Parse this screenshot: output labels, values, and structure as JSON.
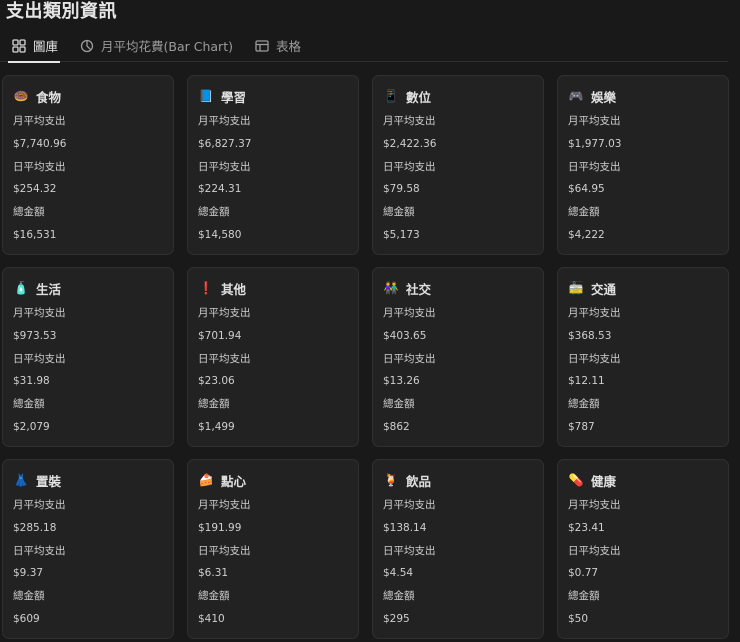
{
  "page": {
    "title": "支出類別資訊"
  },
  "tabs": [
    {
      "label": "圖庫",
      "icon": "gallery-icon",
      "active": true
    },
    {
      "label": "月平均花費(Bar Chart)",
      "icon": "chart-icon",
      "active": false
    },
    {
      "label": "表格",
      "icon": "table-icon",
      "active": false
    }
  ],
  "field_labels": {
    "monthly": "月平均支出",
    "daily": "日平均支出",
    "total": "總金額"
  },
  "cards": [
    {
      "emoji": "🍩",
      "emoji_name": "food-icon",
      "name": "食物",
      "monthly": "$7,740.96",
      "daily": "$254.32",
      "total": "$16,531"
    },
    {
      "emoji": "📘",
      "emoji_name": "book-icon",
      "name": "學習",
      "monthly": "$6,827.37",
      "daily": "$224.31",
      "total": "$14,580"
    },
    {
      "emoji": "📱",
      "emoji_name": "phone-icon",
      "name": "數位",
      "monthly": "$2,422.36",
      "daily": "$79.58",
      "total": "$5,173"
    },
    {
      "emoji": "🎮",
      "emoji_name": "game-icon",
      "name": "娛樂",
      "monthly": "$1,977.03",
      "daily": "$64.95",
      "total": "$4,222"
    },
    {
      "emoji": "🧴",
      "emoji_name": "living-icon",
      "name": "生活",
      "monthly": "$973.53",
      "daily": "$31.98",
      "total": "$2,079"
    },
    {
      "emoji": "❗",
      "emoji_name": "exclamation-icon",
      "name": "其他",
      "monthly": "$701.94",
      "daily": "$23.06",
      "total": "$1,499"
    },
    {
      "emoji": "👫",
      "emoji_name": "people-icon",
      "name": "社交",
      "monthly": "$403.65",
      "daily": "$13.26",
      "total": "$862"
    },
    {
      "emoji": "🚋",
      "emoji_name": "train-icon",
      "name": "交通",
      "monthly": "$368.53",
      "daily": "$12.11",
      "total": "$787"
    },
    {
      "emoji": "👗",
      "emoji_name": "clothing-icon",
      "name": "置裝",
      "monthly": "$285.18",
      "daily": "$9.37",
      "total": "$609"
    },
    {
      "emoji": "🍰",
      "emoji_name": "cake-icon",
      "name": "點心",
      "monthly": "$191.99",
      "daily": "$6.31",
      "total": "$410"
    },
    {
      "emoji": "🍹",
      "emoji_name": "drink-icon",
      "name": "飲品",
      "monthly": "$138.14",
      "daily": "$4.54",
      "total": "$295"
    },
    {
      "emoji": "💊",
      "emoji_name": "medicine-icon",
      "name": "健康",
      "monthly": "$23.41",
      "daily": "$0.77",
      "total": "$50"
    }
  ],
  "colors": {
    "background": "#191919",
    "card": "#222222",
    "border": "#303030",
    "text": "#d4d4d4"
  }
}
